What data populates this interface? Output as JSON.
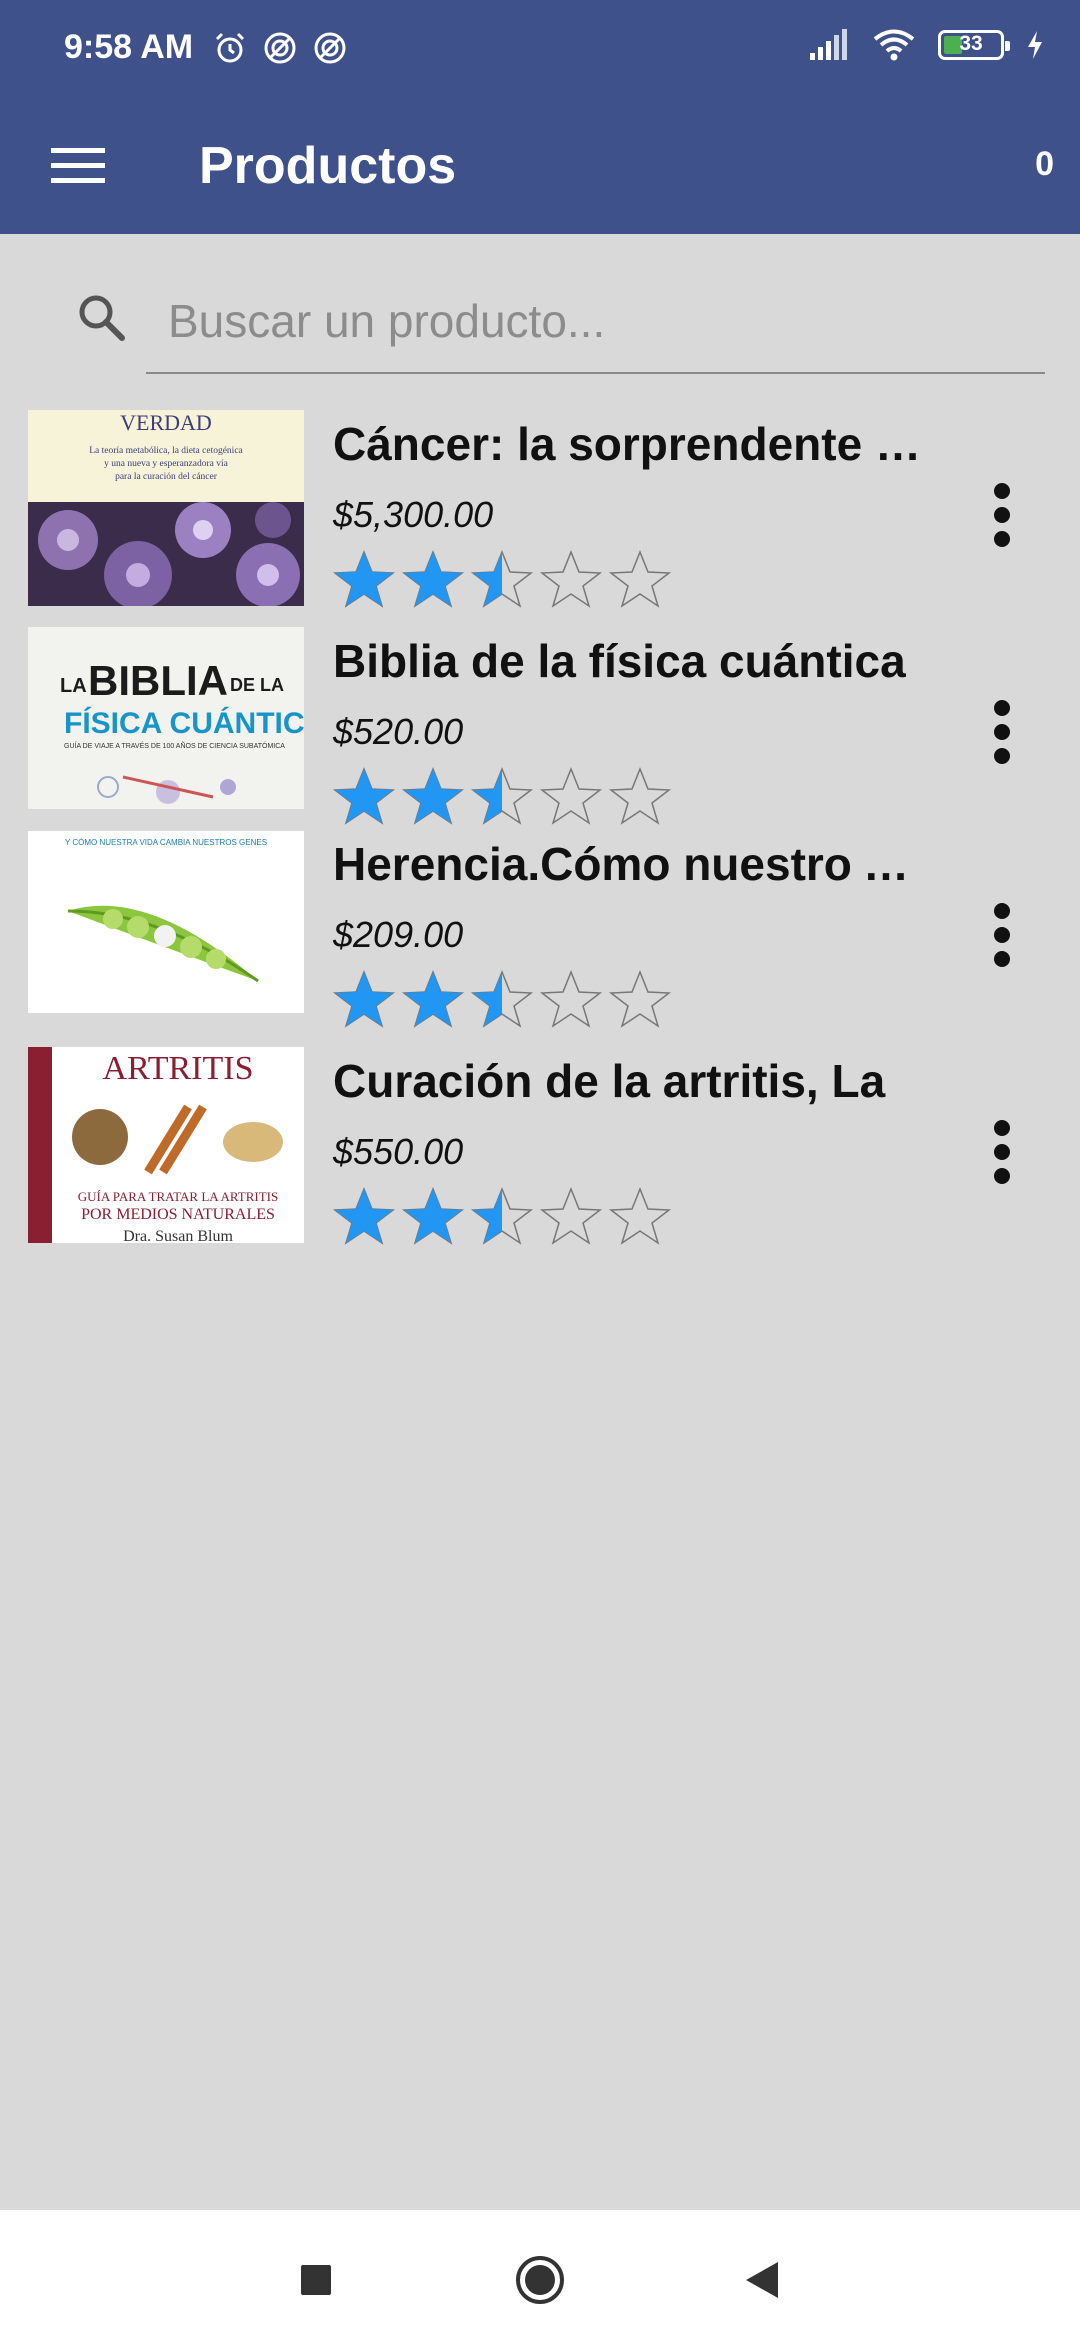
{
  "status_bar": {
    "time": "9:58 AM",
    "battery": "33",
    "battery_level": 0.33,
    "icons": [
      "alarm-icon",
      "do-not-disturb-icon",
      "do-not-disturb-icon",
      "signal-icon",
      "wifi-icon",
      "battery-icon",
      "charging-icon"
    ]
  },
  "app_bar": {
    "title": "Productos",
    "cart_count": "0",
    "menu_icon": "hamburger-menu-icon"
  },
  "search": {
    "placeholder": "Buscar un producto...",
    "value": "",
    "icon": "search-icon"
  },
  "colors": {
    "app_bar": "#3f518a",
    "background": "#d9d9d9",
    "star": "#2196f3",
    "battery_fill": "#4caf50"
  },
  "products": [
    {
      "name": "Cáncer: la sorprendente verdad",
      "price": "$5,300.00",
      "rating": 2.5,
      "max_rating": 5,
      "cover_text": [
        "VERDAD",
        "La teoría metabólica, la dieta cetogénica",
        "y una nueva y esperanzadora vía",
        "para la curación del cáncer"
      ]
    },
    {
      "name": "Biblia de la física cuántica",
      "price": "$520.00",
      "rating": 2.5,
      "max_rating": 5,
      "cover_text": [
        "LA",
        "BIBLIA",
        "DE LA",
        "FÍSICA CUÁNTICA",
        "GUÍA DE VIAJE A TRAVÉS DE 100 AÑOS DE CIENCIA SUBATÓMICA"
      ]
    },
    {
      "name": "Herencia.Cómo nuestro ADN",
      "price": "$209.00",
      "rating": 2.5,
      "max_rating": 5,
      "cover_text": [
        "Y CÓMO NUESTRA VIDA CAMBIA NUESTROS GENES"
      ]
    },
    {
      "name": "Curación de la artritis, La",
      "price": "$550.00",
      "rating": 2.5,
      "max_rating": 5,
      "cover_text": [
        "ARTRITIS",
        "GUÍA PARA TRATAR LA ARTRITIS",
        "POR MEDIOS NATURALES",
        "Dra. Susan Blum"
      ]
    }
  ],
  "nav_bar": {
    "buttons": [
      "recents-icon",
      "home-icon",
      "back-icon"
    ]
  }
}
